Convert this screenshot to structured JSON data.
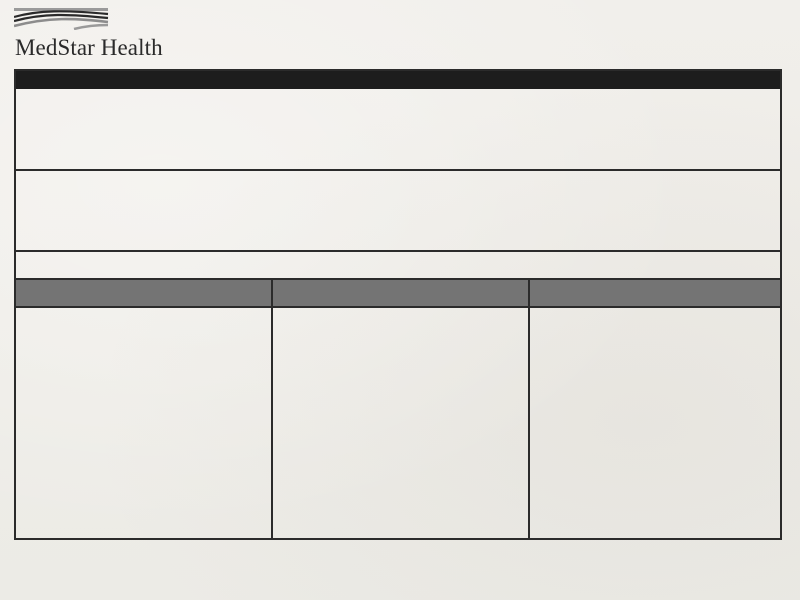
{
  "logo": {
    "name": "MedStar Health"
  },
  "form": {
    "title": "",
    "section1": "",
    "section2": "",
    "section3": "",
    "columns": [
      {
        "header": "",
        "body": ""
      },
      {
        "header": "",
        "body": ""
      },
      {
        "header": "",
        "body": ""
      }
    ]
  },
  "colors": {
    "title_bar": "#1d1d1d",
    "column_header": "#747474",
    "border": "#2b2b2b",
    "background": "#f0eeea"
  }
}
